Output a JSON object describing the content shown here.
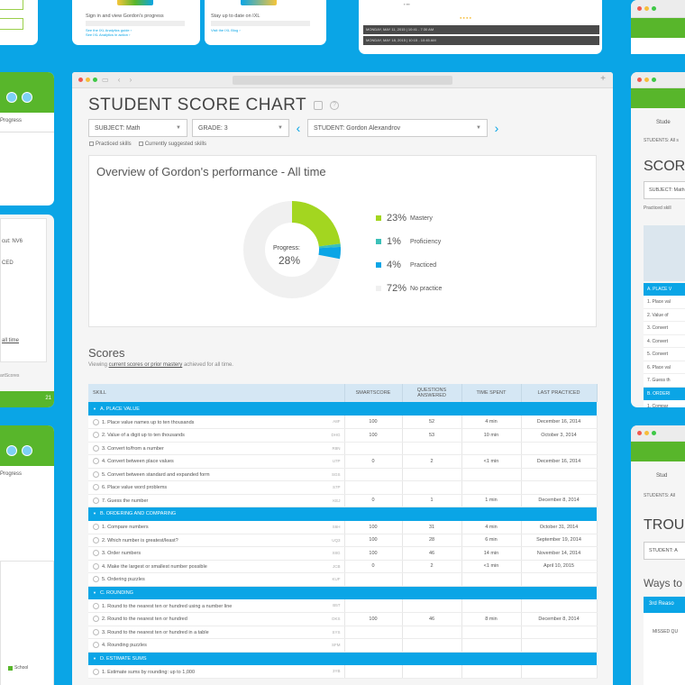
{
  "colors": {
    "background": "#0aa5e6",
    "mastery": "#a3d620",
    "proficiency": "#3bc0b8",
    "practiced": "#0aa5e6",
    "no_practice": "#f0f0f0",
    "brand_green": "#58b62b"
  },
  "top_middle_left": {
    "heading": "Sign in and view Gordon's progress",
    "link_1": "See the IXL Analytics guide ›",
    "link_2": "See IXL Analytics in action ›"
  },
  "top_middle_right": {
    "heading": "Stay up to date on IXL",
    "link_1": "Visit the IXL Blog ›"
  },
  "top_right_dark_rows": [
    "MONDAY, MAY 11, 2015 | 10:41 - 7:30 AM",
    "MONDAY, MAY 18, 2015 | 10:15 - 10:45 AM"
  ],
  "left_top_card": {
    "tab": "Progress"
  },
  "left_mid_card": {
    "line_1": "cut: NV6",
    "line_2": "CED",
    "line_3": "all time",
    "line_4": "artScores",
    "badge": "21"
  },
  "left_bottom_card": {
    "tab": "Progress",
    "legend": "School"
  },
  "right_top_card": {
    "tab": "Stude",
    "crumb": "STUDENTS: All s",
    "title": "SCORE",
    "subject": "SUBJECT: Math",
    "check": "Practiced skill",
    "sections": [
      "A. PLACE V",
      "B. ORDERI",
      "C. ROUNDI"
    ],
    "rows_a": [
      "1. Place val",
      "2. Value of",
      "3. Convert",
      "4. Convert",
      "5. Convert",
      "6. Place val",
      "7. Guess th"
    ],
    "rows_b": [
      "1. Compar",
      "2. Which n",
      "3. Order n",
      "4. Make th",
      "5. Orderin"
    ]
  },
  "right_bottom_card": {
    "tab": "Stud",
    "crumb": "STUDENTS: All",
    "title": "TROU",
    "student": "STUDENT: A",
    "ways": "Ways to",
    "banner": "3rd  Reaso",
    "missed": "MISSED QU"
  },
  "main": {
    "title": "STUDENT SCORE CHART",
    "filters": {
      "subject": "SUBJECT: Math",
      "grade": "GRADE: 3",
      "student": "STUDENT: Gordon Alexandrov"
    },
    "checkboxes": [
      "Practiced skills",
      "Currently suggested skills"
    ],
    "overview": {
      "title": "Overview of Gordon's performance - All time",
      "progress_label": "Progress:",
      "progress_value": "28%",
      "legend": [
        {
          "pct": "23%",
          "label": "Mastery",
          "color": "#a3d620",
          "value": 23
        },
        {
          "pct": "1%",
          "label": "Proficiency",
          "color": "#3bc0b8",
          "value": 1
        },
        {
          "pct": "4%",
          "label": "Practiced",
          "color": "#0aa5e6",
          "value": 4
        },
        {
          "pct": "72%",
          "label": "No practice",
          "color": "#f0f0f0",
          "value": 72
        }
      ]
    },
    "scores_title": "Scores",
    "scores_sub_pre": "Viewing ",
    "scores_sub_link": "current scores or prior mastery",
    "scores_sub_post": " achieved for all time.",
    "table": {
      "headers": [
        "SKILL",
        "SMARTSCORE",
        "QUESTIONS ANSWERED",
        "TIME SPENT",
        "LAST PRACTICED"
      ],
      "sections": [
        {
          "name": "A. PLACE VALUE",
          "rows": [
            {
              "skill": "1. Place value names up to ten thousands",
              "code": "A8F",
              "score": "100",
              "q": "52",
              "time": "4 min",
              "last": "December 16, 2014"
            },
            {
              "skill": "2. Value of a digit up to ten thousands",
              "code": "DHG",
              "score": "100",
              "q": "53",
              "time": "10 min",
              "last": "October 3, 2014"
            },
            {
              "skill": "3. Convert to/from a number",
              "code": "R8N",
              "score": "",
              "q": "",
              "time": "",
              "last": ""
            },
            {
              "skill": "4. Convert between place values",
              "code": "U7P",
              "score": "0",
              "q": "2",
              "time": "<1 min",
              "last": "December 16, 2014"
            },
            {
              "skill": "5. Convert between standard and expanded form",
              "code": "SGS",
              "score": "",
              "q": "",
              "time": "",
              "last": ""
            },
            {
              "skill": "6. Place value word problems",
              "code": "S7P",
              "score": "",
              "q": "",
              "time": "",
              "last": ""
            },
            {
              "skill": "7. Guess the number",
              "code": "KEJ",
              "score": "0",
              "q": "1",
              "time": "1 min",
              "last": "December 8, 2014"
            }
          ]
        },
        {
          "name": "B. ORDERING AND COMPARING",
          "rows": [
            {
              "skill": "1. Compare numbers",
              "code": "S6H",
              "score": "100",
              "q": "31",
              "time": "4 min",
              "last": "October 31, 2014"
            },
            {
              "skill": "2. Which number is greatest/least?",
              "code": "UQ3",
              "score": "100",
              "q": "28",
              "time": "6 min",
              "last": "September 19, 2014"
            },
            {
              "skill": "3. Order numbers",
              "code": "X8G",
              "score": "100",
              "q": "46",
              "time": "14 min",
              "last": "November 14, 2014"
            },
            {
              "skill": "4. Make the largest or smallest number possible",
              "code": "JCB",
              "score": "0",
              "q": "2",
              "time": "<1 min",
              "last": "April 10, 2015"
            },
            {
              "skill": "5. Ordering puzzles",
              "code": "KUF",
              "score": "",
              "q": "",
              "time": "",
              "last": ""
            }
          ]
        },
        {
          "name": "C. ROUNDING",
          "rows": [
            {
              "skill": "1. Round to the nearest ten or hundred using a number line",
              "code": "B5T",
              "score": "",
              "q": "",
              "time": "",
              "last": ""
            },
            {
              "skill": "2. Round to the nearest ten or hundred",
              "code": "DKS",
              "score": "100",
              "q": "46",
              "time": "8 min",
              "last": "December 8, 2014"
            },
            {
              "skill": "3. Round to the nearest ten or hundred in a table",
              "code": "SYS",
              "score": "",
              "q": "",
              "time": "",
              "last": ""
            },
            {
              "skill": "4. Rounding puzzles",
              "code": "SFM",
              "score": "",
              "q": "",
              "time": "",
              "last": ""
            }
          ]
        },
        {
          "name": "D. ESTIMATE SUMS",
          "rows": [
            {
              "skill": "1. Estimate sums by rounding: up to 1,000",
              "code": "3YB",
              "score": "",
              "q": "",
              "time": "",
              "last": ""
            }
          ]
        }
      ]
    }
  }
}
